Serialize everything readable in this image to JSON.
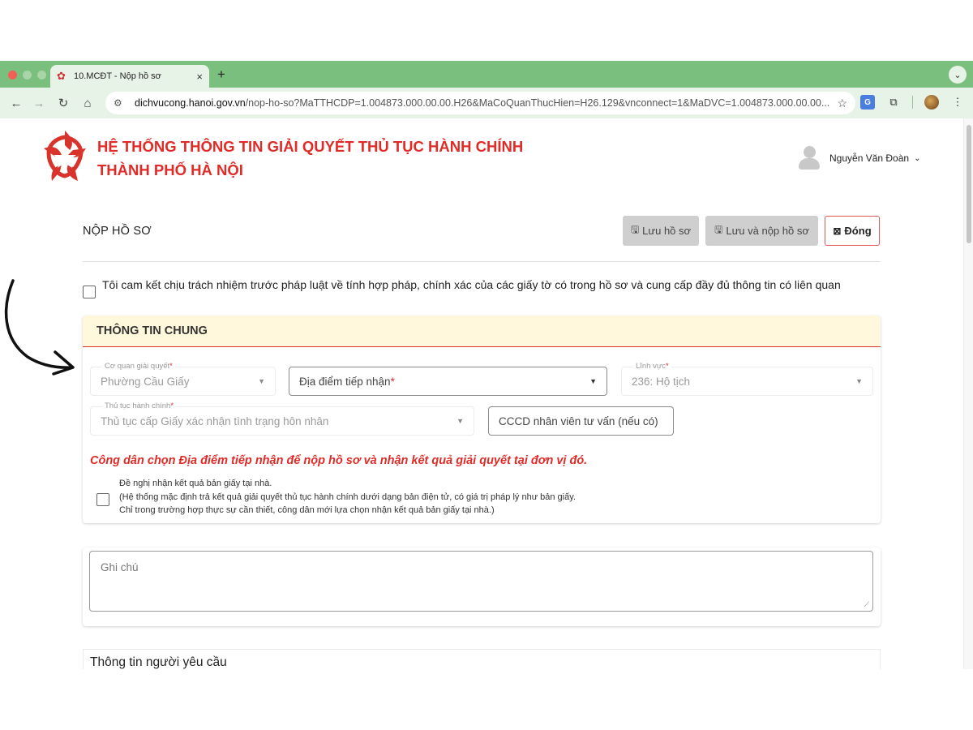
{
  "browser": {
    "tab_title": "10.MCĐT - Nộp hồ sơ",
    "tab_close": "×",
    "new_tab": "+",
    "url_host": "dichvucong.hanoi.gov.vn",
    "url_path": "/nop-ho-so?MaTTHCDP=1.004873.000.00.00.H26&MaCoQuanThucHien=H26.129&vnconnect=1&MaDVC=1.004873.000.00.00...."
  },
  "header": {
    "title_line1": "HỆ THỐNG THÔNG TIN GIẢI QUYẾT THỦ TỤC HÀNH CHÍNH",
    "title_line2": "THÀNH PHỐ HÀ NỘI",
    "user_name": "Nguyễn Văn Đoàn"
  },
  "toolbar": {
    "heading": "NỘP HỒ SƠ",
    "save_label": "Lưu hồ sơ",
    "save_submit_label": "Lưu và nộp hồ sơ",
    "close_label": "Đóng"
  },
  "commitment": "Tôi cam kết chịu trách nhiệm trước pháp luật về tính hợp pháp, chính xác của các giấy tờ có trong hồ sơ và cung cấp đầy đủ thông tin có liên quan",
  "general": {
    "title": "THÔNG TIN CHUNG",
    "agency_label": "Cơ quan giải quyết",
    "agency_value": "Phường Cầu Giấy",
    "location_placeholder": "Địa điểm tiếp nhận",
    "field_label": "Lĩnh vực",
    "field_value": "236: Hộ tịch",
    "procedure_label": "Thủ tục hành chính",
    "procedure_value": "Thủ tục cấp Giấy xác nhận tình trạng hôn nhân",
    "cccd_placeholder": "CCCD nhân viên tư vấn (nếu có)",
    "required_mark": "*",
    "notice": "Công dân chọn Địa điểm tiếp nhận để nộp hồ sơ và nhận kết quả giải quyết tại đơn vị đó.",
    "paper_line1": "Đề nghị nhận kết quả bản giấy tại nhà.",
    "paper_line2": "(Hệ thống mặc định trả kết quả giải quyết thủ tục hành chính dưới dạng bản điện tử, có giá trị pháp lý như bản giấy.",
    "paper_line3": "Chỉ trong trường hợp thực sự cần thiết, công dân mới lựa chọn nhận kết quả bản giấy tại nhà.)"
  },
  "note": {
    "placeholder": "Ghi chú"
  },
  "requester": {
    "title": "Thông tin người yêu cầu"
  },
  "colors": {
    "brand_red": "#e02b27",
    "chrome_green": "#7bbf7e",
    "section_header_bg": "#fff8dc"
  }
}
